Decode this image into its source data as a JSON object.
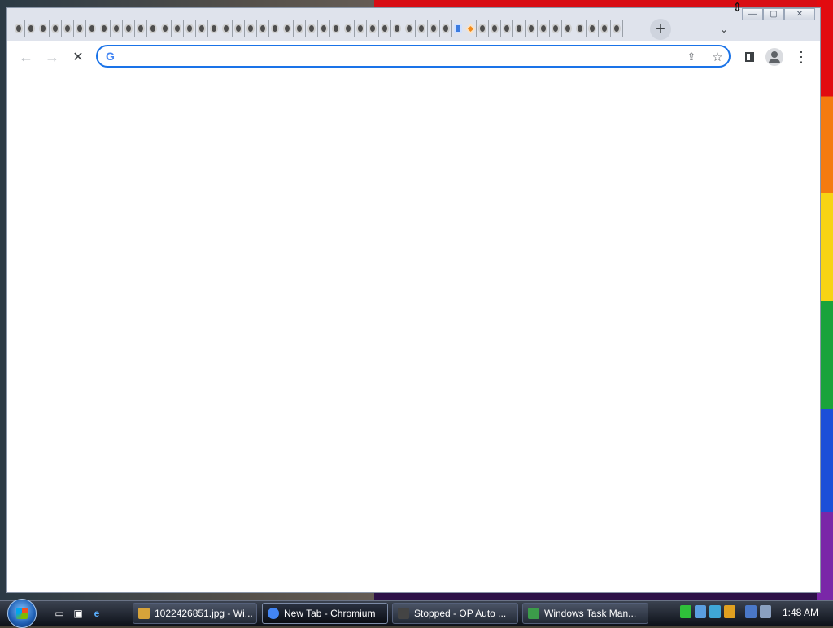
{
  "browser": {
    "tab_count_before_special": 36,
    "tabs_after_special": 12,
    "new_tab_symbol": "+",
    "tab_search_symbol": "⌄",
    "window_controls": {
      "minimize": "—",
      "maximize": "▢",
      "close": "✕"
    }
  },
  "toolbar": {
    "back_symbol": "←",
    "forward_symbol": "→",
    "stop_symbol": "✕",
    "omnibox_provider": "G",
    "omnibox_value": "",
    "share_symbol": "⇪",
    "bookmark_symbol": "☆",
    "menu_symbol": "⋮"
  },
  "taskbar": {
    "quick_launch": [
      "show-desktop-icon",
      "switch-windows-icon",
      "internet-explorer-icon"
    ],
    "items": [
      {
        "label": "1022426851.jpg - Wi...",
        "icon_color": "#d6a33a",
        "active": false
      },
      {
        "label": "New Tab - Chromium",
        "icon_color": "#4285f4",
        "active": true
      },
      {
        "label": "Stopped - OP Auto ...",
        "icon_color": "#444444",
        "active": false
      },
      {
        "label": "Windows Task Man...",
        "icon_color": "#3c9c4a",
        "active": false
      }
    ],
    "clock": "1:48 AM"
  },
  "colors": {
    "accent": "#1a73e8",
    "tabstrip": "#dfe3ec"
  }
}
